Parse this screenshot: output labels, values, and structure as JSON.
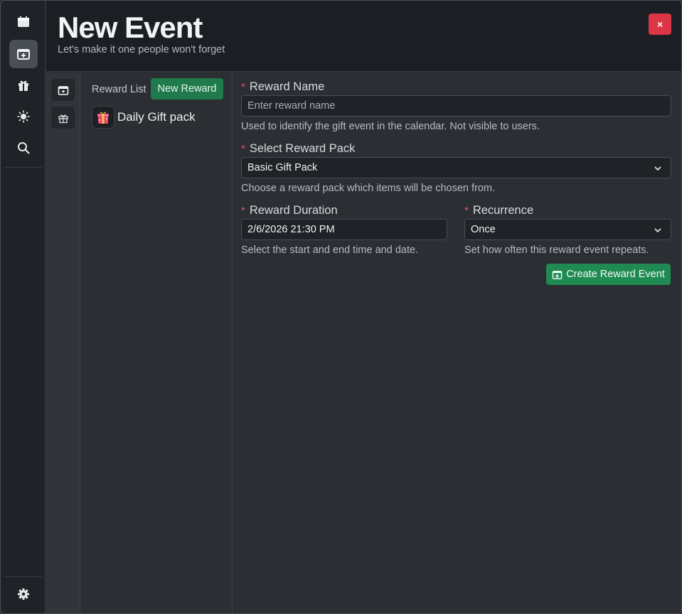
{
  "header": {
    "title": "New Event",
    "subtitle": "Let's make it one people won't forget",
    "close_label": "×"
  },
  "rail": {
    "items": [
      "calendar-icon",
      "calendar-add-icon",
      "gift-icon",
      "sun-icon",
      "search-icon"
    ],
    "active": "calendar-add-icon",
    "bottom": "gear-icon"
  },
  "reward_list": {
    "label": "Reward List",
    "new_button": "New Reward",
    "items": [
      {
        "label": "Daily Gift pack"
      }
    ]
  },
  "form": {
    "reward_name": {
      "label": "Reward Name",
      "placeholder": "Enter reward name",
      "help": "Used to identify the gift event in the calendar. Not visible to users."
    },
    "reward_pack": {
      "label": "Select Reward Pack",
      "value": "Basic Gift Pack",
      "help": "Choose a reward pack which items will be chosen from."
    },
    "duration": {
      "label": "Reward Duration",
      "value": "2/6/2026 21:30 PM",
      "help": "Select the start and end time and date."
    },
    "recurrence": {
      "label": "Recurrence",
      "value": "Once",
      "help": "Set how often this reward event repeats."
    },
    "required_mark": "*",
    "create_button": "Create Reward Event"
  },
  "colors": {
    "accent_green": "#1f8a52",
    "danger": "#dc3545",
    "required": "#e25563"
  }
}
